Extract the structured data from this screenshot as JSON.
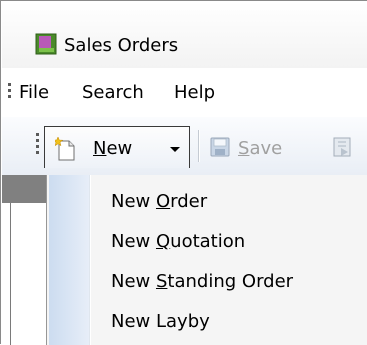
{
  "window": {
    "title": "Sales Orders",
    "icon": "app-icon"
  },
  "menubar": {
    "items": [
      {
        "label": "File"
      },
      {
        "label": "Search"
      },
      {
        "label": "Help"
      }
    ]
  },
  "toolbar": {
    "new_button": {
      "prefix": "",
      "mnemonic": "N",
      "suffix": "ew",
      "icon": "new-document-icon"
    },
    "save_button": {
      "prefix": "",
      "mnemonic": "S",
      "suffix": "ave",
      "icon": "save-icon",
      "enabled": false
    },
    "next_icon": "document-arrow-icon"
  },
  "dropdown": {
    "items": [
      {
        "prefix": "New ",
        "mnemonic": "O",
        "suffix": "rder"
      },
      {
        "prefix": "New ",
        "mnemonic": "Q",
        "suffix": "uotation"
      },
      {
        "prefix": "New ",
        "mnemonic": "S",
        "suffix": "tanding Order"
      },
      {
        "prefix": "New Layby",
        "mnemonic": "",
        "suffix": ""
      }
    ]
  },
  "colors": {
    "gutter": "#ccdcf0",
    "menu_background": "#f5f5f5",
    "disabled_text": "#a0a0a0"
  }
}
